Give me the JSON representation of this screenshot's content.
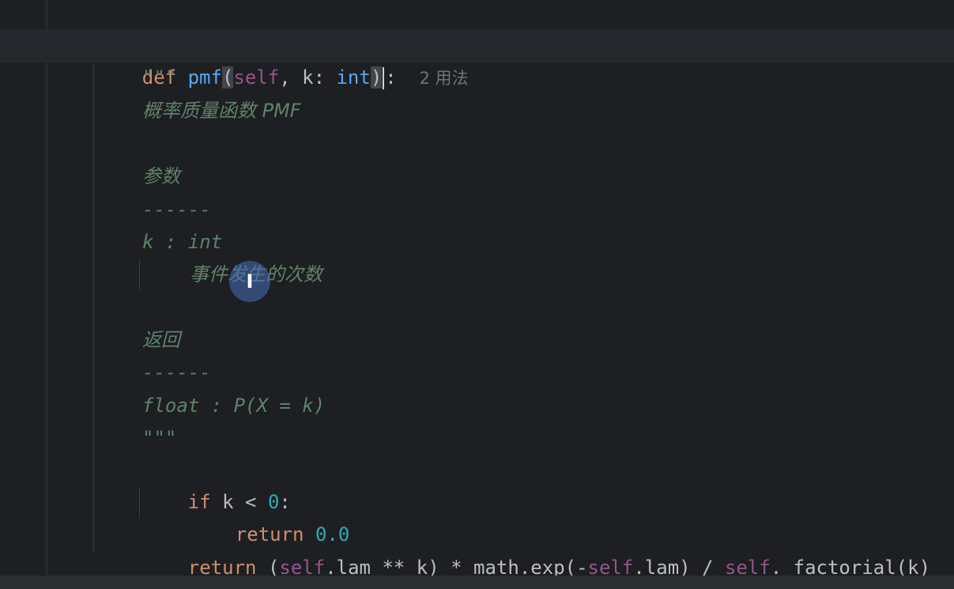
{
  "code": {
    "def_line": {
      "kw_def": "def",
      "fn_name": "pmf",
      "open_paren": "(",
      "param_self": "self",
      "sep1": ", k: ",
      "type_int": "int",
      "close_paren": ")",
      "colon": ":",
      "usage_hint": "2 用法"
    },
    "docstring": {
      "open_quotes": "\"\"\"",
      "summary": "概率质量函数 PMF",
      "params_header": "参数",
      "params_rule": "------",
      "param_decl": "k : int",
      "param_desc": "事件发生的次数",
      "returns_header": "返回",
      "returns_rule": "------",
      "returns_decl": "float : P(X = k)",
      "close_quotes": "\"\"\""
    },
    "if_line": {
      "kw_if": "if",
      "cond": " k < ",
      "zero": "0",
      "colon": ":"
    },
    "return_zero_line": {
      "kw_return": "return",
      "value": "0.0"
    },
    "return_line": {
      "kw_return": "return",
      "part1": " (",
      "self1": "self",
      "part2": ".lam ** k) * math.exp(-",
      "self2": "self",
      "part3": ".lam) / ",
      "self3": "self",
      "part4": "._factorial(k)"
    }
  },
  "colors": {
    "background": "#1e1f22",
    "keyword": "#cf8e6d",
    "function": "#56a8f5",
    "self": "#94558d",
    "number": "#2aacb8",
    "docstring": "#5f826b",
    "hint": "#6f737a"
  },
  "icons": {
    "cursor": "text-cursor-icon"
  },
  "cursor_glyph": "I"
}
